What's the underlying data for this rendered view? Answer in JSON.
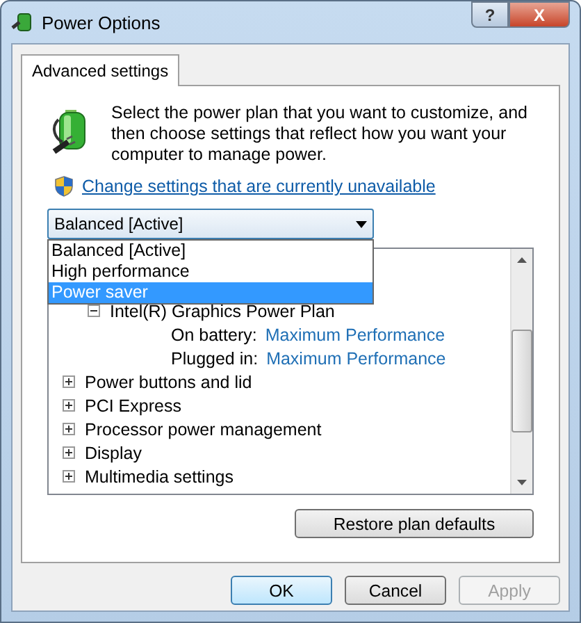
{
  "window": {
    "title": "Power Options"
  },
  "title_buttons": [
    {
      "kind": "help",
      "label": "?"
    },
    {
      "kind": "close",
      "label": "X"
    }
  ],
  "tabs": [
    {
      "label": "Advanced settings",
      "selected": true
    }
  ],
  "intro": "Select the power plan that you want to customize, and then choose settings that reflect how you want your computer to manage power.",
  "change_link": "Change settings that are currently unavailable",
  "plan_dropdown": {
    "value": "Balanced [Active]",
    "expanded": true,
    "options": [
      {
        "label": "Balanced [Active]",
        "highlighted": false
      },
      {
        "label": "High performance",
        "highlighted": false
      },
      {
        "label": "Power saver",
        "highlighted": true
      }
    ]
  },
  "tree": {
    "items": [
      {
        "label": "Intel(R) Graphics Power Plan",
        "expanded": true,
        "children": [
          {
            "name": "On battery:",
            "value": "Maximum Performance"
          },
          {
            "name": "Plugged in:",
            "value": "Maximum Performance"
          }
        ]
      },
      {
        "label": "Power buttons and lid",
        "expanded": false
      },
      {
        "label": "PCI Express",
        "expanded": false
      },
      {
        "label": "Processor power management",
        "expanded": false
      },
      {
        "label": "Display",
        "expanded": false
      },
      {
        "label": "Multimedia settings",
        "expanded": false
      }
    ]
  },
  "restore_button": "Restore plan defaults",
  "buttons": [
    {
      "label": "OK",
      "default": true,
      "disabled": false
    },
    {
      "label": "Cancel",
      "default": false,
      "disabled": false
    },
    {
      "label": "Apply",
      "default": false,
      "disabled": true
    }
  ]
}
